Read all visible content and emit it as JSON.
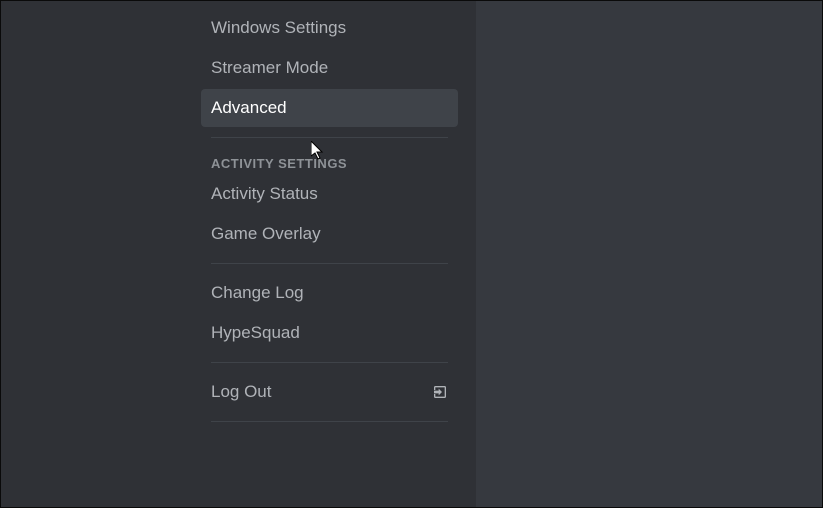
{
  "sidebar": {
    "app_settings": {
      "windows_settings": "Windows Settings",
      "streamer_mode": "Streamer Mode",
      "advanced": "Advanced"
    },
    "activity_section_header": "ACTIVITY SETTINGS",
    "activity_settings": {
      "activity_status": "Activity Status",
      "game_overlay": "Game Overlay"
    },
    "misc": {
      "change_log": "Change Log",
      "hypesquad": "HypeSquad"
    },
    "log_out": "Log Out"
  }
}
